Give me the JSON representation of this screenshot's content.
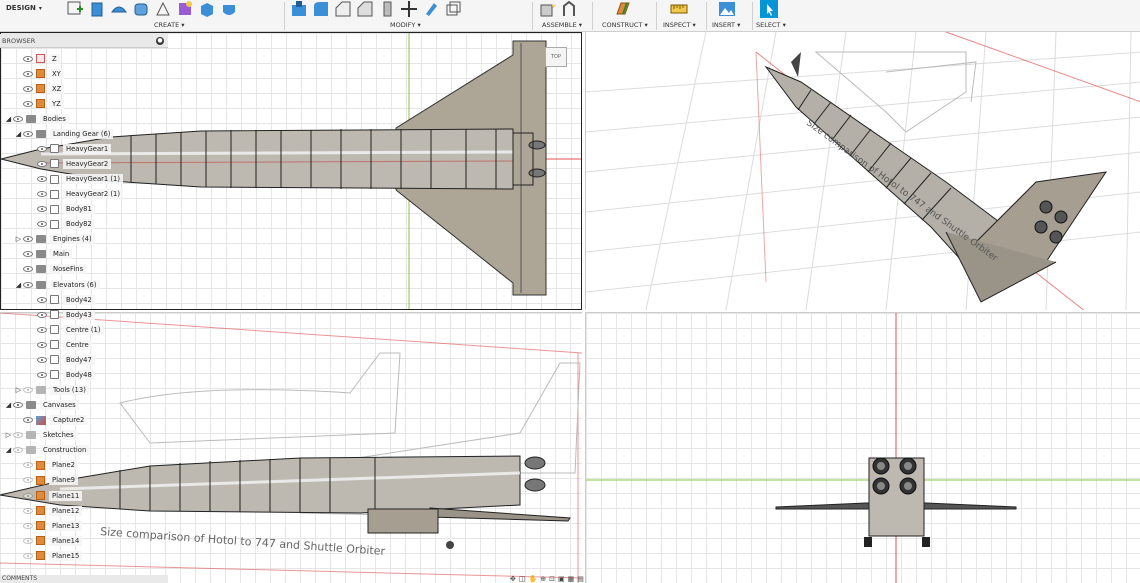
{
  "workspace": {
    "label": "DESIGN"
  },
  "toolbar": {
    "groups": [
      {
        "label": "CREATE"
      },
      {
        "label": "MODIFY"
      },
      {
        "label": "ASSEMBLE"
      },
      {
        "label": "CONSTRUCT"
      },
      {
        "label": "INSPECT"
      },
      {
        "label": "INSERT"
      },
      {
        "label": "SELECT"
      }
    ]
  },
  "browser": {
    "title": "BROWSER",
    "rows": [
      {
        "label": "Z",
        "icon": "origin-axis-icon",
        "indent": 1
      },
      {
        "label": "XY",
        "icon": "origin-plane-icon",
        "indent": 1
      },
      {
        "label": "XZ",
        "icon": "origin-plane-icon",
        "indent": 1
      },
      {
        "label": "YZ",
        "icon": "origin-plane-icon",
        "indent": 1
      },
      {
        "label": "Bodies",
        "icon": "folder-icon",
        "indent": 0,
        "expanded": true
      },
      {
        "label": "Landing Gear (6)",
        "icon": "folder-icon",
        "indent": 1,
        "expanded": true
      },
      {
        "label": "HeavyGear1",
        "icon": "body-icon",
        "indent": 2
      },
      {
        "label": "HeavyGear2",
        "icon": "body-icon",
        "indent": 2
      },
      {
        "label": "HeavyGear1 (1)",
        "icon": "body-icon",
        "indent": 2
      },
      {
        "label": "HeavyGear2 (1)",
        "icon": "body-icon",
        "indent": 2
      },
      {
        "label": "Body81",
        "icon": "body-icon",
        "indent": 2
      },
      {
        "label": "Body82",
        "icon": "body-icon",
        "indent": 2
      },
      {
        "label": "Engines (4)",
        "icon": "folder-icon",
        "indent": 1,
        "expanded": false
      },
      {
        "label": "Main",
        "icon": "folder-icon",
        "indent": 1
      },
      {
        "label": "NoseFins",
        "icon": "folder-icon",
        "indent": 1
      },
      {
        "label": "Elevators (6)",
        "icon": "folder-icon",
        "indent": 1,
        "expanded": true
      },
      {
        "label": "Body42",
        "icon": "body-icon",
        "indent": 2
      },
      {
        "label": "Body43",
        "icon": "body-icon",
        "indent": 2
      },
      {
        "label": "Centre (1)",
        "icon": "body-icon",
        "indent": 2
      },
      {
        "label": "Centre",
        "icon": "body-icon",
        "indent": 2
      },
      {
        "label": "Body47",
        "icon": "body-icon",
        "indent": 2
      },
      {
        "label": "Body48",
        "icon": "body-icon",
        "indent": 2
      },
      {
        "label": "Tools (13)",
        "icon": "folder-icon",
        "indent": 1,
        "expanded": false,
        "dim": true
      },
      {
        "label": "Canvases",
        "icon": "folder-icon",
        "indent": 0,
        "expanded": true
      },
      {
        "label": "Capture2",
        "icon": "canvas-icon",
        "indent": 1
      },
      {
        "label": "Sketches",
        "icon": "folder-icon",
        "indent": -1,
        "expanded": false,
        "dim": true
      },
      {
        "label": "Construction",
        "icon": "folder-icon",
        "indent": 0,
        "expanded": true,
        "dim": true
      },
      {
        "label": "Plane2",
        "icon": "plane-icon",
        "indent": 1,
        "dim": true
      },
      {
        "label": "Plane9",
        "icon": "plane-icon",
        "indent": 1,
        "dim": true
      },
      {
        "label": "Plane11",
        "icon": "plane-icon",
        "indent": 1,
        "dim": true
      },
      {
        "label": "Plane12",
        "icon": "plane-icon",
        "indent": 1,
        "dim": true
      },
      {
        "label": "Plane13",
        "icon": "plane-icon",
        "indent": 1,
        "dim": true
      },
      {
        "label": "Plane14",
        "icon": "plane-icon",
        "indent": 1,
        "dim": true
      },
      {
        "label": "Plane15",
        "icon": "plane-icon",
        "indent": 1,
        "dim": true
      }
    ]
  },
  "canvas_text": "Size comparison of Hotol to 747 and Shuttle Orbiter",
  "viewcube_label": "TOP",
  "comments": {
    "title": "COMMENTS"
  },
  "colors": {
    "accent": "#0696d7",
    "axis_red": "#e05050",
    "axis_green": "#4caf50",
    "body_fill": "#a8a39a"
  }
}
